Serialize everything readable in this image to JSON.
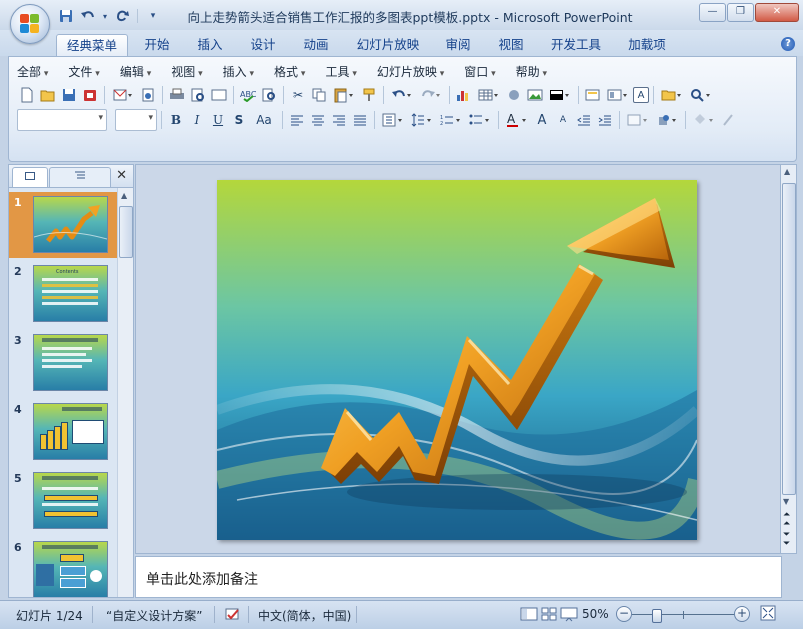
{
  "window": {
    "title": "向上走势箭头适合销售工作汇报的多图表ppt模板.pptx - Microsoft PowerPoint",
    "controls": [
      "minimize-icon",
      "restore-icon",
      "close-icon"
    ]
  },
  "qat": {
    "icons": [
      "save-icon",
      "undo-icon",
      "redo-icon",
      "customize-qat-icon"
    ]
  },
  "ribbon_tabs": [
    "经典菜单",
    "开始",
    "插入",
    "设计",
    "动画",
    "幻灯片放映",
    "审阅",
    "视图",
    "开发工具",
    "加载项"
  ],
  "active_tab": "经典菜单",
  "classic_menus": [
    "全部",
    "文件",
    "编辑",
    "视图",
    "插入",
    "格式",
    "工具",
    "幻灯片放映",
    "窗口",
    "帮助"
  ],
  "toolbar": {
    "row1_icons": [
      "new-icon",
      "open-icon",
      "save-icon",
      "permission-icon",
      "email-dropdown-icon",
      "publish-icon",
      "print-icon",
      "print-preview-icon",
      "slide-frame-icon",
      "spelling-icon",
      "research-icon",
      "cut-icon",
      "copy-icon",
      "paste-dropdown-icon",
      "format-painter-icon",
      "undo-dropdown-icon",
      "redo-dropdown-icon",
      "chart-icon",
      "table-dropdown-icon",
      "clipart-icon",
      "picture-icon",
      "textbox-dropdown-icon",
      "new-slide-icon",
      "layout-dropdown-icon",
      "text-frame-icon",
      "folder-dropdown-icon",
      "zoom-dropdown-icon"
    ],
    "format_labels": {
      "bold": "B",
      "italic": "I",
      "underline": "U",
      "shadow": "S",
      "case": "Aa",
      "font_grow": "A",
      "font_shrink": "A"
    }
  },
  "slide_panel": {
    "tabs": [
      "slides-tab",
      "outline-tab"
    ],
    "slides": [
      {
        "number": "1",
        "selected": true
      },
      {
        "number": "2",
        "selected": false,
        "heading": "Contents"
      },
      {
        "number": "3",
        "selected": false
      },
      {
        "number": "4",
        "selected": false
      },
      {
        "number": "5",
        "selected": false
      },
      {
        "number": "6",
        "selected": false
      }
    ]
  },
  "notes": {
    "placeholder": "单击此处添加备注"
  },
  "status": {
    "slide_info": "幻灯片 1/24",
    "theme": "“自定义设计方案”",
    "language": "中文(简体，中国)",
    "zoom": "50%",
    "zoom_level": 0.5
  }
}
